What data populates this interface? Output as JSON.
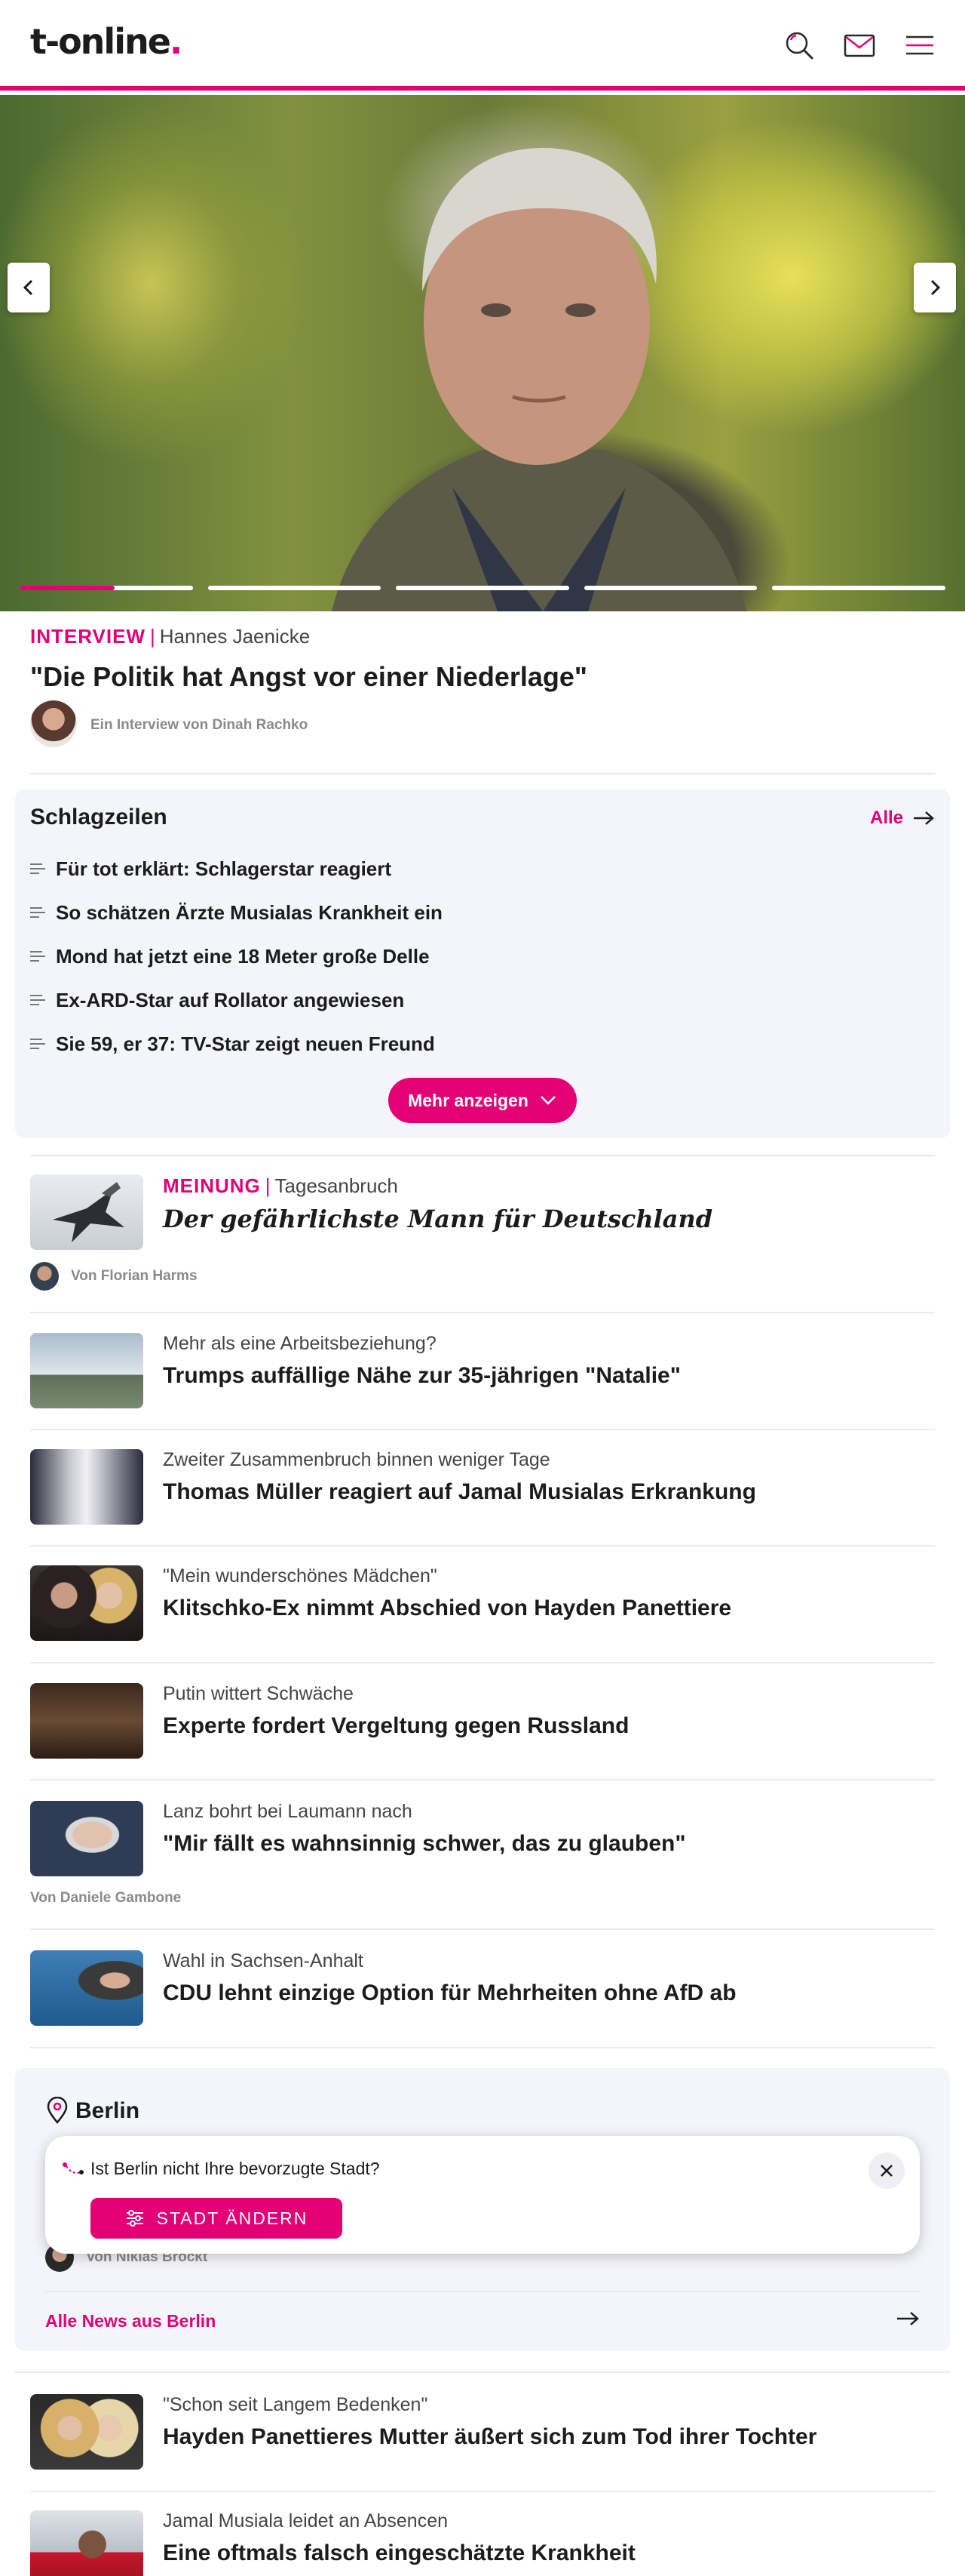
{
  "header": {
    "logo_text": "t-online",
    "logo_dot": ".",
    "icons": [
      "search-icon",
      "mail-icon",
      "menu-icon"
    ],
    "accent": "#e20074"
  },
  "hero": {
    "slides_total": 5,
    "active_slide": 1,
    "active_progress": 0.55,
    "kicker": "INTERVIEW",
    "kicker_sep": "|",
    "kicker_name": "Hannes Jaenicke",
    "title": "\"Die Politik hat Angst vor einer Niederlage\"",
    "author": "Ein Interview von Dinah Rachko"
  },
  "headlines": {
    "title": "Schlagzeilen",
    "all_label": "Alle",
    "items": [
      "Für tot erklärt: Schlagerstar reagiert",
      "So schätzen Ärzte Musialas Krankheit ein",
      "Mond hat jetzt eine 18 Meter große Delle",
      "Ex-ARD-Star auf Rollator angewiesen",
      "Sie 59, er 37: TV-Star zeigt neuen Freund"
    ],
    "more_label": "Mehr anzeigen"
  },
  "articles": [
    {
      "kicker": "MEINUNG",
      "kicker_sep": "|",
      "overline": "Tagesanbruch",
      "title": "Der gefährlichste Mann für Deutschland",
      "author": "Von Florian Harms"
    },
    {
      "overline": "Mehr als eine Arbeitsbeziehung?",
      "title": "Trumps auffällige Nähe zur 35-jährigen \"Natalie\""
    },
    {
      "overline": "Zweiter Zusammenbruch binnen weniger Tage",
      "title": "Thomas Müller reagiert auf Jamal Musialas Erkrankung"
    },
    {
      "overline": "\"Mein wunderschönes Mädchen\"",
      "title": "Klitschko-Ex nimmt Abschied von Hayden Panettiere"
    },
    {
      "overline": "Putin wittert Schwäche",
      "title": "Experte fordert Vergeltung gegen Russland"
    },
    {
      "overline": "Lanz bohrt bei Laumann nach",
      "title": "\"Mir fällt es wahnsinnig schwer, das zu glauben\"",
      "author": "Von Daniele Gambone"
    },
    {
      "overline": "Wahl in Sachsen-Anhalt",
      "title": "CDU lehnt einzige Option für Mehrheiten ohne AfD ab"
    }
  ],
  "berlin": {
    "title": "Berlin",
    "popup_question": "Ist Berlin nicht Ihre bevorzugte Stadt?",
    "change_button": "STADT ÄNDERN",
    "faded_author": "Von Niklas Brockt",
    "all_news": "Alle News aus Berlin"
  },
  "more_articles": [
    {
      "overline": "\"Schon seit Langem Bedenken\"",
      "title": "Hayden Panettieres Mutter äußert sich zum Tod ihrer Tochter"
    },
    {
      "overline": "Jamal Musiala leidet an Absencen",
      "title": "Eine oftmals falsch eingeschätzte Krankheit"
    }
  ]
}
